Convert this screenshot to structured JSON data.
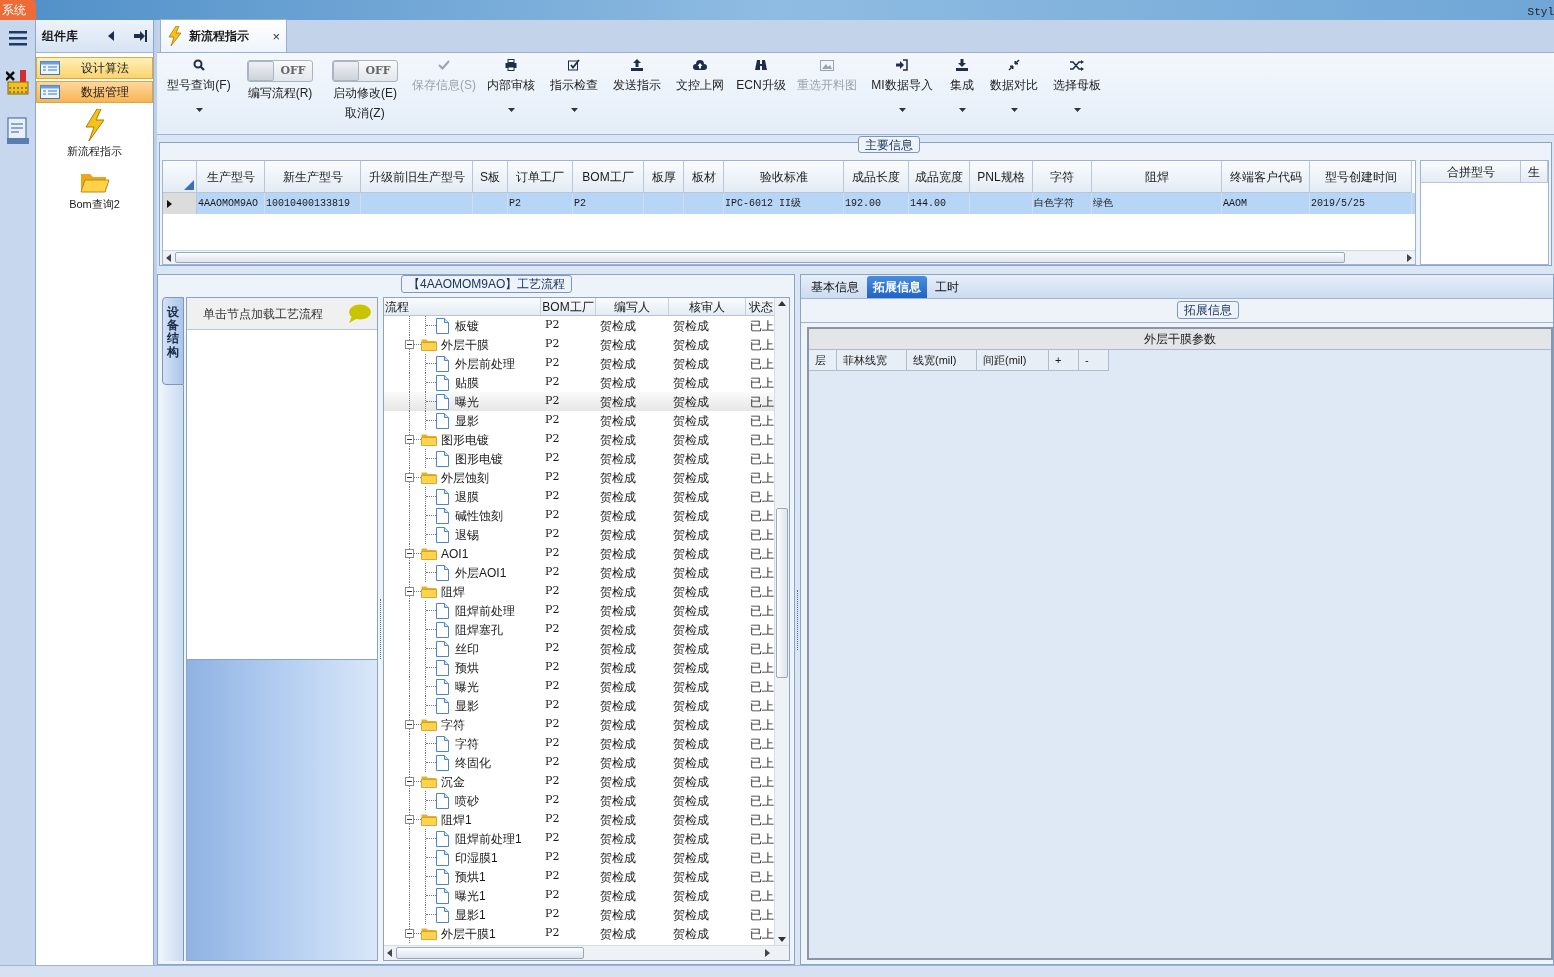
{
  "title_bar": {
    "app_tab": "系统",
    "right_text": "Styl"
  },
  "side_panel": {
    "title": "组件库",
    "categories": [
      {
        "label": "设计算法",
        "selected": false
      },
      {
        "label": "数据管理",
        "selected": true
      }
    ],
    "tools": [
      {
        "label": "新流程指示",
        "kind": "lightning"
      },
      {
        "label": "Bom查询2",
        "kind": "folder"
      }
    ]
  },
  "document_tab": {
    "title": "新流程指示",
    "close": "×"
  },
  "toolbar": [
    {
      "kind": "button",
      "label": "型号查询(F)",
      "disabled": false,
      "dropdown": true
    },
    {
      "kind": "toggle",
      "toggle_text": "OFF",
      "on": false,
      "label": "编写流程(R)"
    },
    {
      "kind": "toggle",
      "toggle_text": "OFF",
      "on": false,
      "label": "启动修改(E)",
      "sublabel": "取消(Z)"
    },
    {
      "kind": "button",
      "label": "保存信息(S)",
      "disabled": true,
      "dropdown": false
    },
    {
      "kind": "button",
      "label": "内部审核",
      "disabled": false,
      "dropdown": true
    },
    {
      "kind": "button",
      "label": "指示检查",
      "disabled": false,
      "dropdown": true
    },
    {
      "kind": "button",
      "label": "发送指示",
      "disabled": false,
      "dropdown": false
    },
    {
      "kind": "button",
      "label": "文控上网",
      "disabled": false,
      "dropdown": false
    },
    {
      "kind": "button",
      "label": "ECN升级",
      "disabled": false,
      "dropdown": false
    },
    {
      "kind": "button",
      "label": "重选开料图",
      "disabled": true,
      "dropdown": false
    },
    {
      "kind": "button",
      "label": "MI数据导入",
      "disabled": false,
      "dropdown": true
    },
    {
      "kind": "button",
      "label": "集成",
      "disabled": false,
      "dropdown": true
    },
    {
      "kind": "button",
      "label": "数据对比",
      "disabled": false,
      "dropdown": true
    },
    {
      "kind": "button",
      "label": "选择母板",
      "disabled": false,
      "dropdown": true
    }
  ],
  "main_info": {
    "caption": "主要信息",
    "columns": [
      "生产型号",
      "新生产型号",
      "升级前旧生产型号",
      "S板",
      "订单工厂",
      "BOM工厂",
      "板厚",
      "板材",
      "验收标准",
      "成品长度",
      "成品宽度",
      "PNL规格",
      "字符",
      "阻焊",
      "终端客户代码",
      "型号创建时间"
    ],
    "rows": [
      {
        "selected": true,
        "cells": [
          "4AAOMOM9AO",
          "10010400133819",
          "",
          "",
          "P2",
          "P2",
          "",
          "",
          "IPC-6012 II级",
          "192.00",
          "144.00",
          "",
          "白色字符",
          "绿色",
          "AAOM",
          "2019/5/25"
        ]
      }
    ],
    "side_columns": [
      "合拼型号",
      "生"
    ]
  },
  "process": {
    "caption": "【4AAOMOM9AO】工艺流程",
    "side_tab": "设备结构",
    "hint": "单击节点加载工艺流程",
    "columns": [
      "流程",
      "BOM工厂",
      "编写人",
      "核审人",
      "状态"
    ],
    "tree": [
      {
        "kind": "file",
        "name": "板镀",
        "bom": "P2",
        "writer": "贺检成",
        "reviewer": "贺检成",
        "status": "已上",
        "selected": false
      },
      {
        "kind": "folder",
        "name": "外层干膜",
        "bom": "P2",
        "writer": "贺检成",
        "reviewer": "贺检成",
        "status": "已上",
        "selected": false,
        "expanded": true,
        "children": [
          {
            "kind": "file",
            "name": "外层前处理",
            "bom": "P2",
            "writer": "贺检成",
            "reviewer": "贺检成",
            "status": "已上",
            "selected": false
          },
          {
            "kind": "file",
            "name": "贴膜",
            "bom": "P2",
            "writer": "贺检成",
            "reviewer": "贺检成",
            "status": "已上",
            "selected": false
          },
          {
            "kind": "file",
            "name": "曝光",
            "bom": "P2",
            "writer": "贺检成",
            "reviewer": "贺检成",
            "status": "已上",
            "selected": true
          },
          {
            "kind": "file",
            "name": "显影",
            "bom": "P2",
            "writer": "贺检成",
            "reviewer": "贺检成",
            "status": "已上",
            "selected": false
          }
        ]
      },
      {
        "kind": "folder",
        "name": "图形电镀",
        "bom": "P2",
        "writer": "贺检成",
        "reviewer": "贺检成",
        "status": "已上",
        "selected": false,
        "expanded": true,
        "children": [
          {
            "kind": "file",
            "name": "图形电镀",
            "bom": "P2",
            "writer": "贺检成",
            "reviewer": "贺检成",
            "status": "已上",
            "selected": false
          }
        ]
      },
      {
        "kind": "folder",
        "name": "外层蚀刻",
        "bom": "P2",
        "writer": "贺检成",
        "reviewer": "贺检成",
        "status": "已上",
        "selected": false,
        "expanded": true,
        "children": [
          {
            "kind": "file",
            "name": "退膜",
            "bom": "P2",
            "writer": "贺检成",
            "reviewer": "贺检成",
            "status": "已上",
            "selected": false
          },
          {
            "kind": "file",
            "name": "碱性蚀刻",
            "bom": "P2",
            "writer": "贺检成",
            "reviewer": "贺检成",
            "status": "已上",
            "selected": false
          },
          {
            "kind": "file",
            "name": "退锡",
            "bom": "P2",
            "writer": "贺检成",
            "reviewer": "贺检成",
            "status": "已上",
            "selected": false
          }
        ]
      },
      {
        "kind": "folder",
        "name": "AOI1",
        "bom": "P2",
        "writer": "贺检成",
        "reviewer": "贺检成",
        "status": "已上",
        "selected": false,
        "expanded": true,
        "children": [
          {
            "kind": "file",
            "name": "外层AOI1",
            "bom": "P2",
            "writer": "贺检成",
            "reviewer": "贺检成",
            "status": "已上",
            "selected": false
          }
        ]
      },
      {
        "kind": "folder",
        "name": "阻焊",
        "bom": "P2",
        "writer": "贺检成",
        "reviewer": "贺检成",
        "status": "已上",
        "selected": false,
        "expanded": true,
        "children": [
          {
            "kind": "file",
            "name": "阻焊前处理",
            "bom": "P2",
            "writer": "贺检成",
            "reviewer": "贺检成",
            "status": "已上",
            "selected": false
          },
          {
            "kind": "file",
            "name": "阻焊塞孔",
            "bom": "P2",
            "writer": "贺检成",
            "reviewer": "贺检成",
            "status": "已上",
            "selected": false
          },
          {
            "kind": "file",
            "name": "丝印",
            "bom": "P2",
            "writer": "贺检成",
            "reviewer": "贺检成",
            "status": "已上",
            "selected": false
          },
          {
            "kind": "file",
            "name": "预烘",
            "bom": "P2",
            "writer": "贺检成",
            "reviewer": "贺检成",
            "status": "已上",
            "selected": false
          },
          {
            "kind": "file",
            "name": "曝光",
            "bom": "P2",
            "writer": "贺检成",
            "reviewer": "贺检成",
            "status": "已上",
            "selected": false
          },
          {
            "kind": "file",
            "name": "显影",
            "bom": "P2",
            "writer": "贺检成",
            "reviewer": "贺检成",
            "status": "已上",
            "selected": false
          }
        ]
      },
      {
        "kind": "folder",
        "name": "字符",
        "bom": "P2",
        "writer": "贺检成",
        "reviewer": "贺检成",
        "status": "已上",
        "selected": false,
        "expanded": true,
        "children": [
          {
            "kind": "file",
            "name": "字符",
            "bom": "P2",
            "writer": "贺检成",
            "reviewer": "贺检成",
            "status": "已上",
            "selected": false
          },
          {
            "kind": "file",
            "name": "终固化",
            "bom": "P2",
            "writer": "贺检成",
            "reviewer": "贺检成",
            "status": "已上",
            "selected": false
          }
        ]
      },
      {
        "kind": "folder",
        "name": "沉金",
        "bom": "P2",
        "writer": "贺检成",
        "reviewer": "贺检成",
        "status": "已上",
        "selected": false,
        "expanded": true,
        "children": [
          {
            "kind": "file",
            "name": "喷砂",
            "bom": "P2",
            "writer": "贺检成",
            "reviewer": "贺检成",
            "status": "已上",
            "selected": false
          }
        ]
      },
      {
        "kind": "folder",
        "name": "阻焊1",
        "bom": "P2",
        "writer": "贺检成",
        "reviewer": "贺检成",
        "status": "已上",
        "selected": false,
        "expanded": true,
        "children": [
          {
            "kind": "file",
            "name": "阻焊前处理1",
            "bom": "P2",
            "writer": "贺检成",
            "reviewer": "贺检成",
            "status": "已上",
            "selected": false
          },
          {
            "kind": "file",
            "name": "印湿膜1",
            "bom": "P2",
            "writer": "贺检成",
            "reviewer": "贺检成",
            "status": "已上",
            "selected": false
          },
          {
            "kind": "file",
            "name": "预烘1",
            "bom": "P2",
            "writer": "贺检成",
            "reviewer": "贺检成",
            "status": "已上",
            "selected": false
          },
          {
            "kind": "file",
            "name": "曝光1",
            "bom": "P2",
            "writer": "贺检成",
            "reviewer": "贺检成",
            "status": "已上",
            "selected": false
          },
          {
            "kind": "file",
            "name": "显影1",
            "bom": "P2",
            "writer": "贺检成",
            "reviewer": "贺检成",
            "status": "已上",
            "selected": false
          }
        ]
      },
      {
        "kind": "folder",
        "name": "外层干膜1",
        "bom": "P2",
        "writer": "贺检成",
        "reviewer": "贺检成",
        "status": "已上",
        "selected": false,
        "expanded": true
      }
    ]
  },
  "detail": {
    "tabs": [
      {
        "label": "基本信息",
        "selected": false
      },
      {
        "label": "拓展信息",
        "selected": true
      },
      {
        "label": "工时",
        "selected": false
      }
    ],
    "caption": "拓展信息",
    "section_title": "外层干膜参数",
    "columns": [
      "层",
      "菲林线宽",
      "线宽(mil)",
      "间距(mil)",
      "+",
      "-"
    ]
  }
}
